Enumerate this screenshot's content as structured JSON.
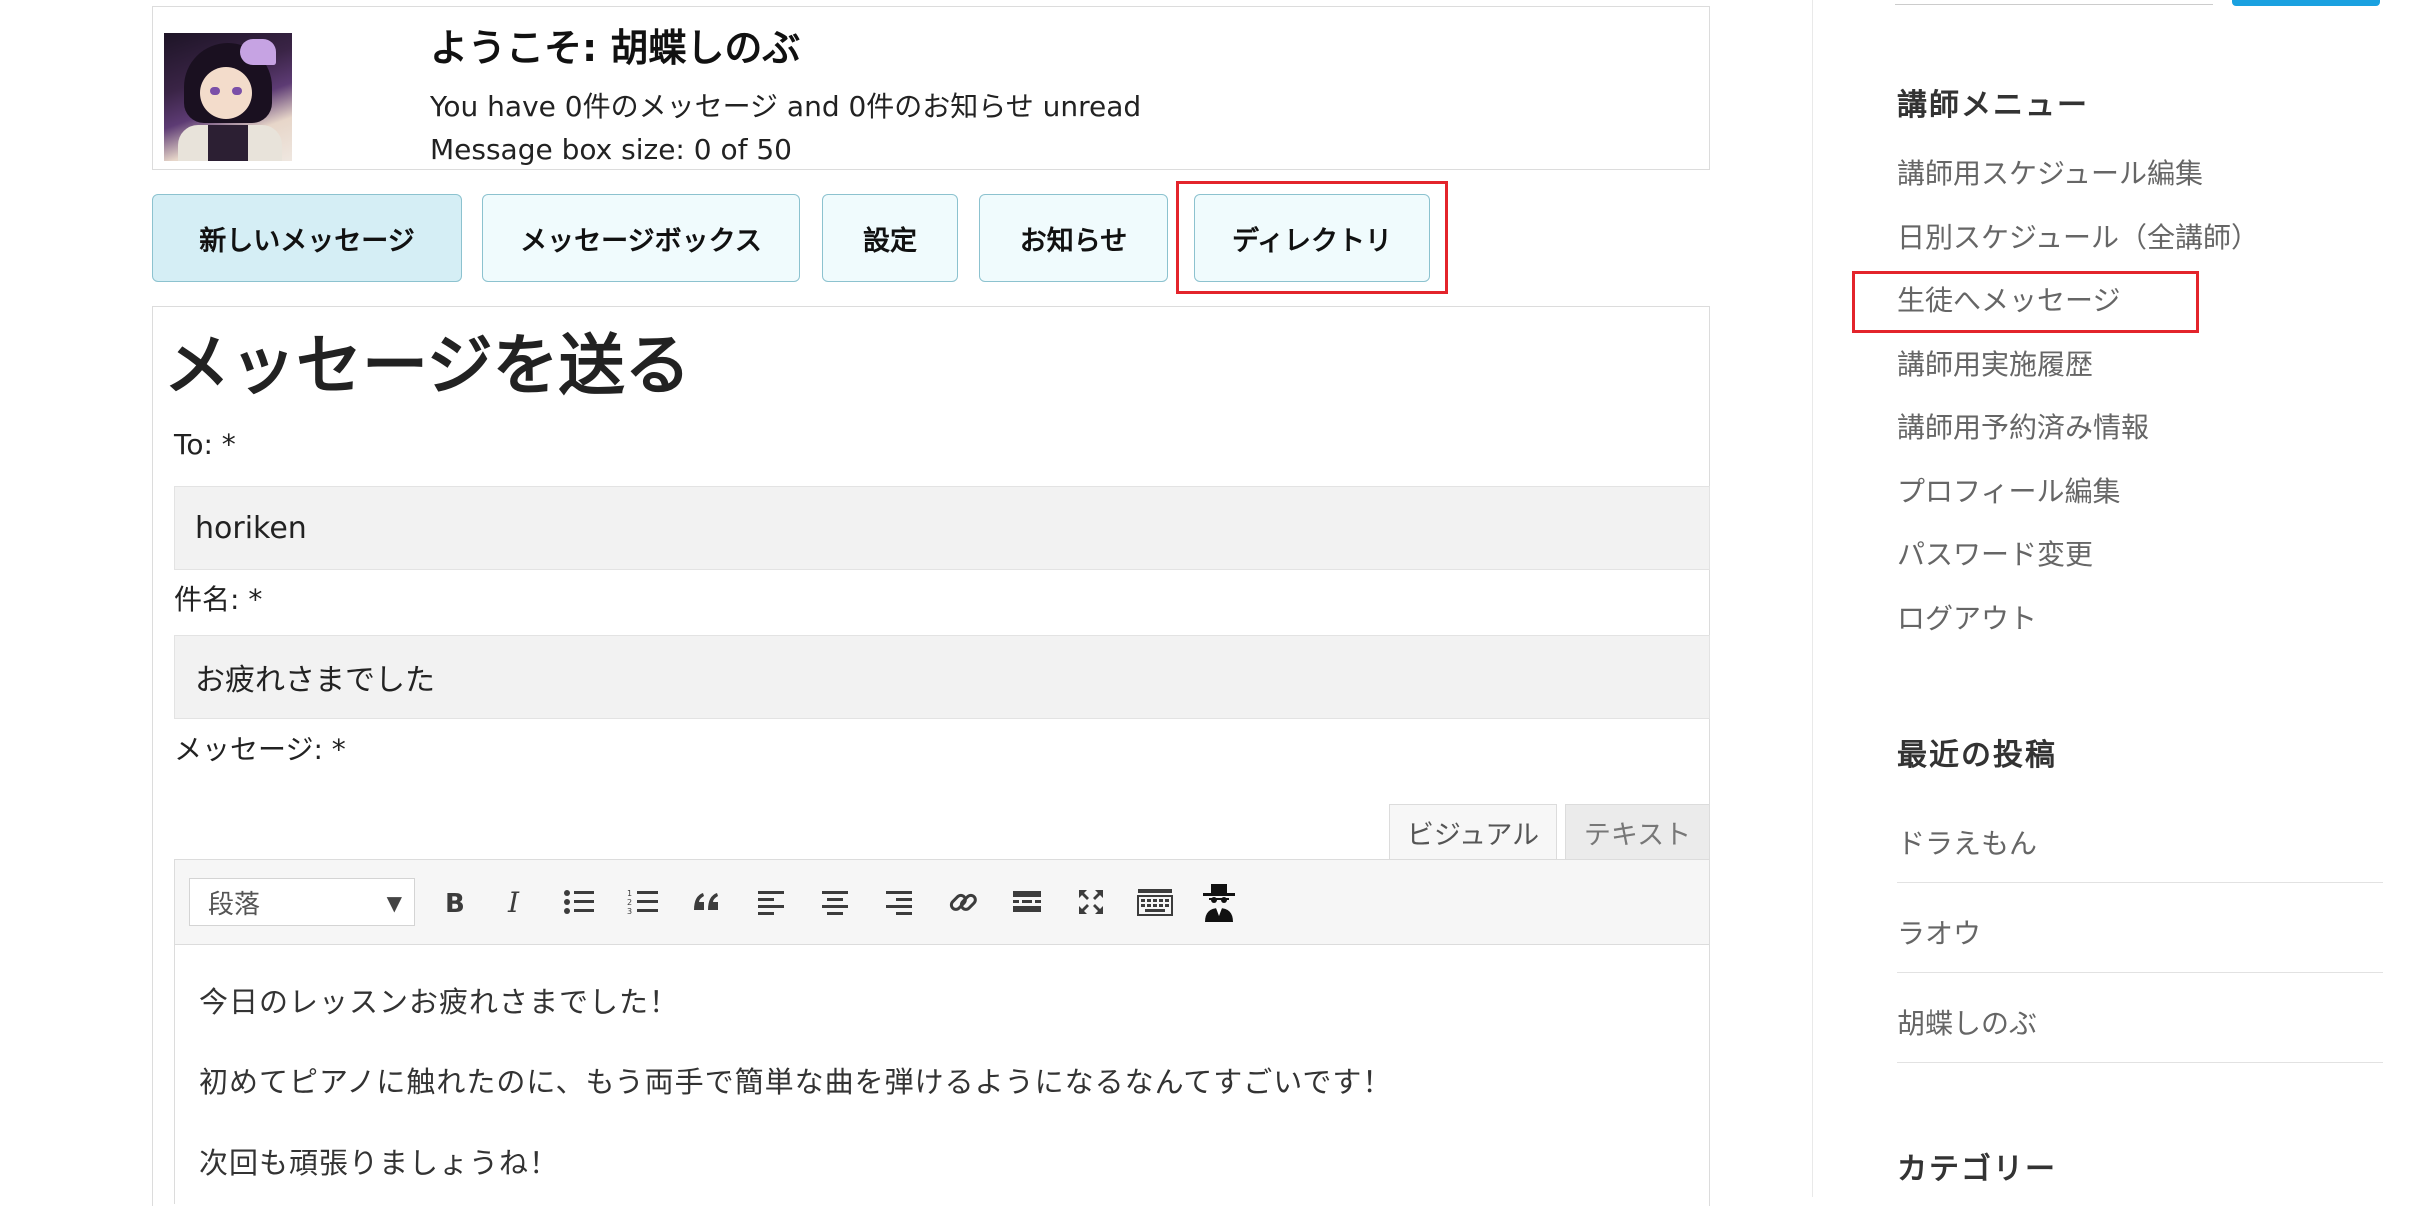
{
  "header": {
    "welcome": "ようこそ: 胡蝶しのぶ",
    "unread": "You have 0件のメッセージ and 0件のお知らせ unread",
    "box_size": "Message box size: 0 of 50"
  },
  "nav_buttons": {
    "new_message": "新しいメッセージ",
    "message_box": "メッセージボックス",
    "settings": "設定",
    "notices": "お知らせ",
    "directory": "ディレクトリ"
  },
  "form": {
    "title": "メッセージを送る",
    "to_label": "To: *",
    "to_value": "horiken",
    "subject_label": "件名: *",
    "subject_value": "お疲れさまでした",
    "message_label": "メッセージ: *"
  },
  "editor": {
    "tab_visual": "ビジュアル",
    "tab_text": "テキスト",
    "format_value": "段落",
    "toolbar_icons": [
      "bold-icon",
      "italic-icon",
      "bullet-list-icon",
      "numbered-list-icon",
      "blockquote-icon",
      "align-left-icon",
      "align-center-icon",
      "align-right-icon",
      "link-icon",
      "read-more-icon",
      "fullscreen-icon",
      "keyboard-icon",
      "spy-icon"
    ],
    "lines": [
      "今日のレッスンお疲れさまでした！",
      "初めてピアノに触れたのに、もう両手で簡単な曲を弾けるようになるなんてすごいです！",
      "次回も頑張りましょうね！"
    ]
  },
  "sidebar": {
    "menu_heading": "講師メニュー",
    "menu_items": [
      "講師用スケジュール編集",
      "日別スケジュール（全講師）",
      "生徒へメッセージ",
      "講師用実施履歴",
      "講師用予約済み情報",
      "プロフィール編集",
      "パスワード変更",
      "ログアウト"
    ],
    "recent_heading": "最近の投稿",
    "recent_items": [
      "ドラえもん",
      "ラオウ",
      "胡蝶しのぶ"
    ],
    "category_heading": "カテゴリー"
  },
  "colors": {
    "highlight": "#e3242b",
    "button_border": "#8cc2cf",
    "button_bg": "#f0fbfd",
    "button_active_bg": "#d5eef5"
  }
}
